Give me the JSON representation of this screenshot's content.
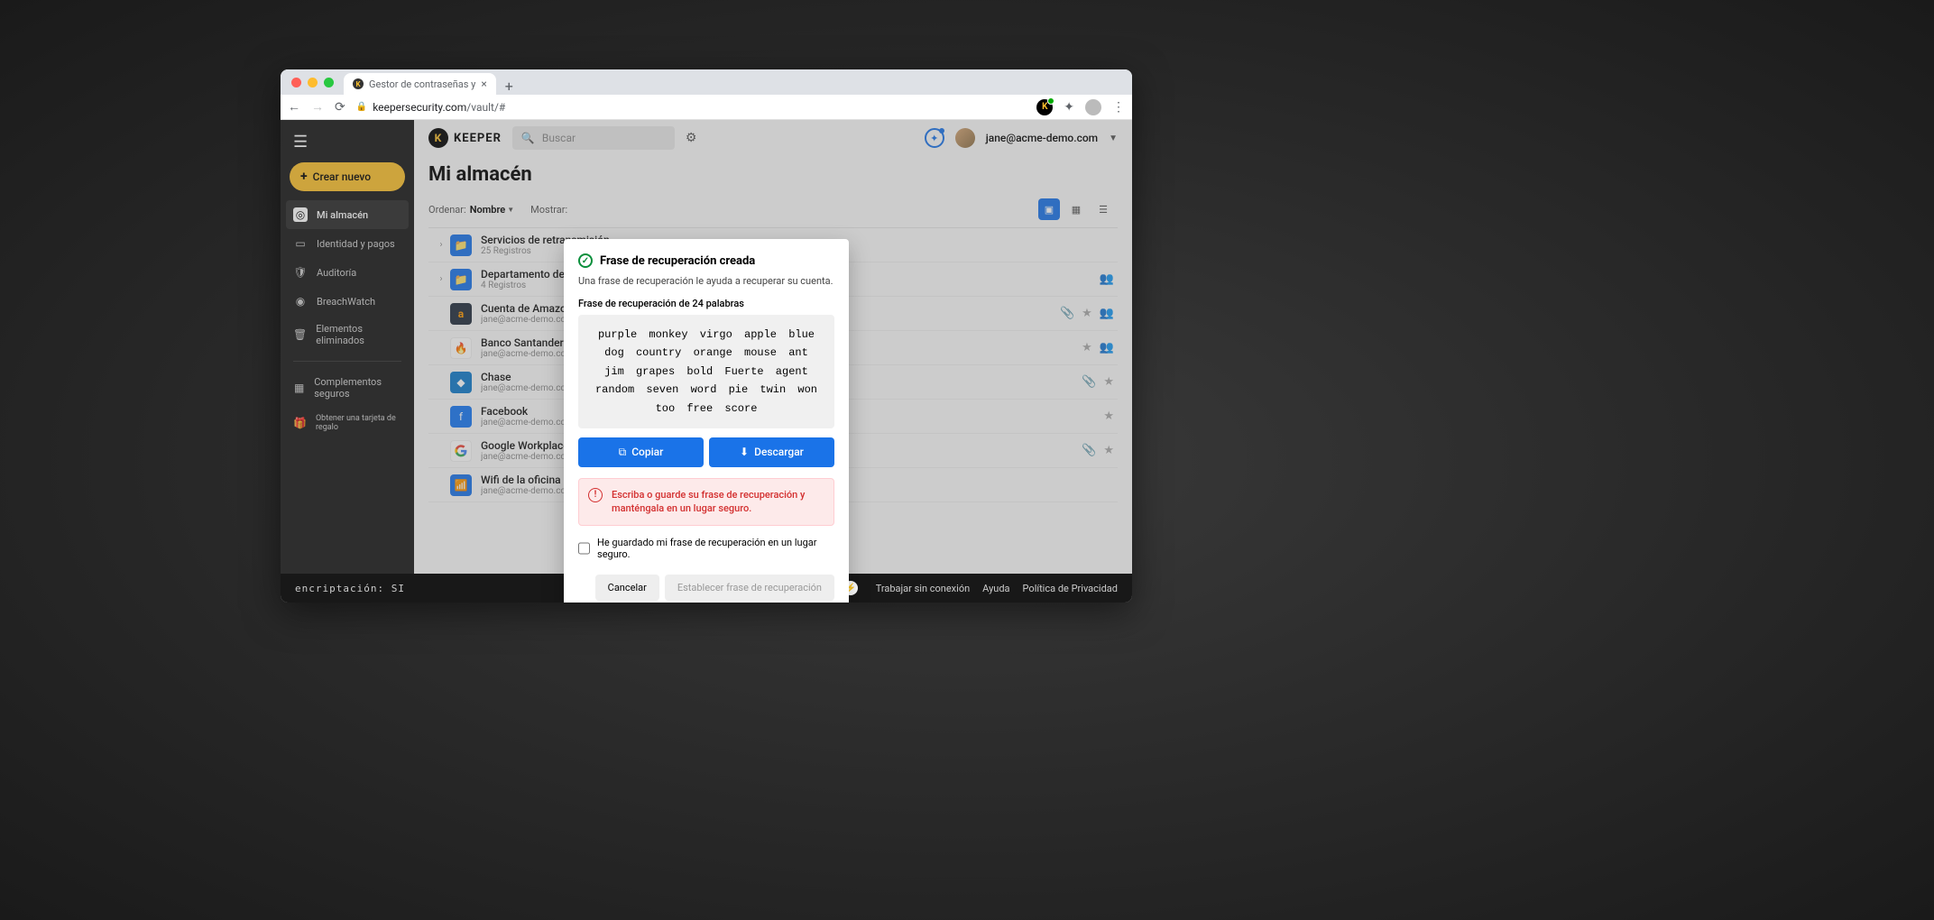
{
  "browser": {
    "tab_title": "Gestor de contraseñas y",
    "url_host": "keepersecurity.com",
    "url_path": "/vault/#"
  },
  "sidebar": {
    "create_label": "Crear nuevo",
    "items": [
      {
        "label": "Mi almacén"
      },
      {
        "label": "Identidad y pagos"
      },
      {
        "label": "Auditoría"
      },
      {
        "label": "BreachWatch"
      },
      {
        "label": "Elementos eliminados"
      }
    ],
    "secondary": [
      {
        "label": "Complementos seguros"
      },
      {
        "label": "Obtener una tarjeta de regalo"
      }
    ]
  },
  "header": {
    "brand": "KEEPER",
    "search_placeholder": "Buscar",
    "user_email": "jane@acme-demo.com"
  },
  "vault": {
    "title": "Mi almacén",
    "sort_label": "Ordenar:",
    "sort_value": "Nombre",
    "show_label": "Mostrar:"
  },
  "rows": [
    {
      "title": "Servicios de retransmisión",
      "sub": "25 Registros",
      "folder": true
    },
    {
      "title": "Departamento de finanzas",
      "sub": "4 Registros",
      "folder": true
    },
    {
      "title": "Cuenta de Amazon",
      "sub": "jane@acme-demo.com"
    },
    {
      "title": "Banco Santander",
      "sub": "jane@acme-demo.com"
    },
    {
      "title": "Chase",
      "sub": "jane@acme-demo.com"
    },
    {
      "title": "Facebook",
      "sub": "jane@acme-demo.com"
    },
    {
      "title": "Google Workplace",
      "sub": "jane@acme-demo.com"
    },
    {
      "title": "Wifi de la oficina",
      "sub": "jane@acme-demo.com"
    }
  ],
  "dialog": {
    "title": "Frase de recuperación creada",
    "description": "Una frase de recuperación le ayuda a recuperar su cuenta.",
    "phrase_label": "Frase de recuperación de 24 palabras",
    "phrase": "purple monkey virgo apple blue dog country orange mouse ant jim grapes bold Fuerte agent random seven word pie twin won too free score",
    "copy_label": "Copiar",
    "download_label": "Descargar",
    "warning": "Escriba o guarde su frase de recuperación y manténgala en un lugar seguro.",
    "checkbox_label": "He guardado mi frase de recuperación en un lugar seguro.",
    "cancel_label": "Cancelar",
    "confirm_label": "Establecer frase de recuperación"
  },
  "status": {
    "encryption": "encriptación: SI",
    "offline": "Trabajar sin conexión",
    "help": "Ayuda",
    "privacy": "Política de Privacidad"
  }
}
